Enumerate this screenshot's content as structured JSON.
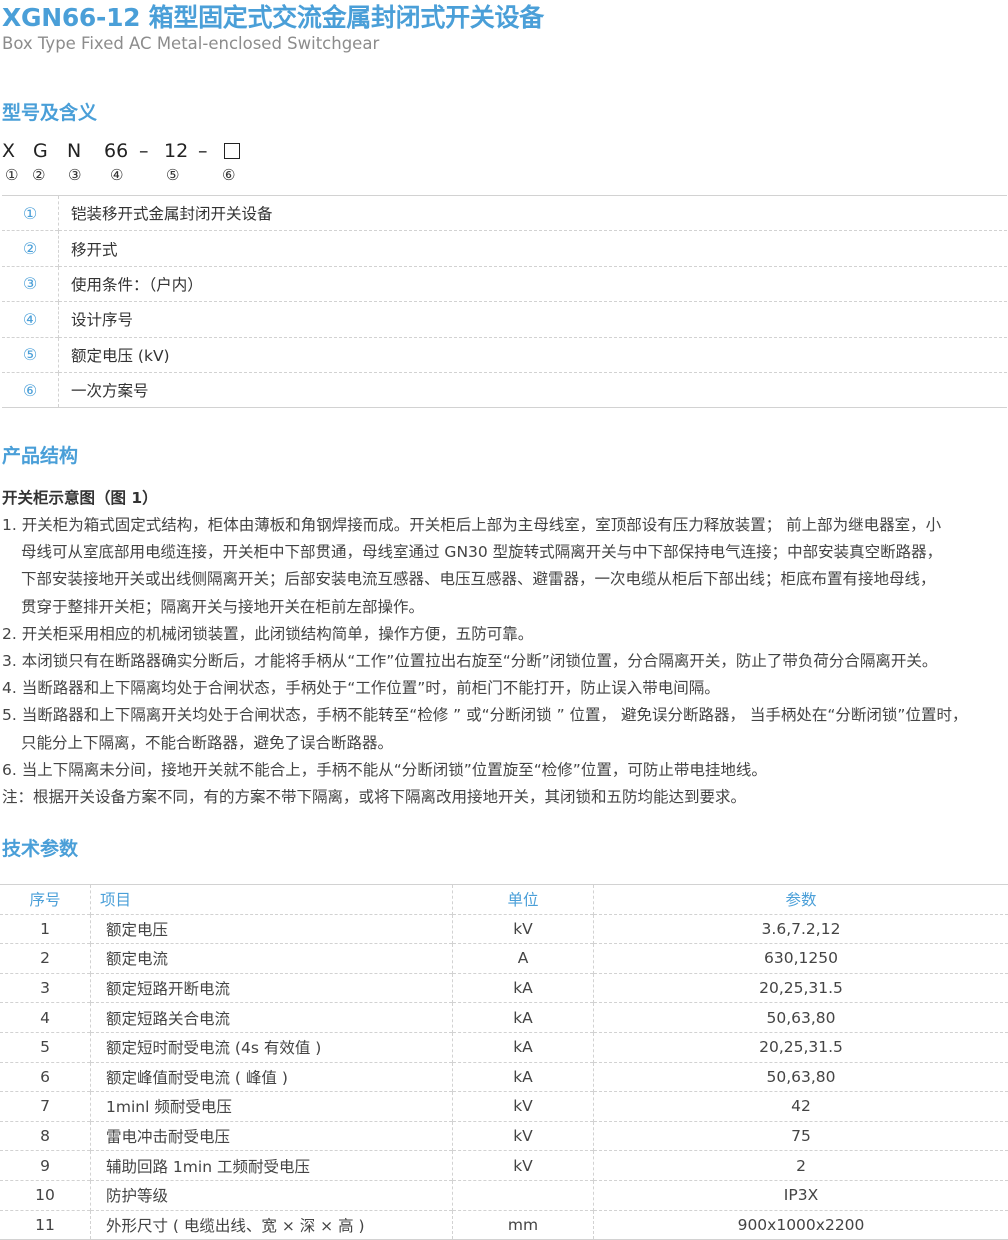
{
  "header": {
    "title": "XGN66-12 箱型固定式交流金属封闭式开关设备",
    "subtitle": "Box Type Fixed AC Metal-enclosed Switchgear"
  },
  "model_section": {
    "heading": "型号及含义",
    "code_parts": [
      "X",
      "G",
      "N",
      "66",
      "–",
      "12",
      "–"
    ],
    "circled": [
      "①",
      "②",
      "③",
      "④",
      "⑤",
      "⑥"
    ],
    "meanings": [
      {
        "num": "①",
        "text": "铠装移开式金属封闭开关设备"
      },
      {
        "num": "②",
        "text": "移开式"
      },
      {
        "num": "③",
        "text": "使用条件：（户内）"
      },
      {
        "num": "④",
        "text": "设计序号"
      },
      {
        "num": "⑤",
        "text": "额定电压 (kV)"
      },
      {
        "num": "⑥",
        "text": "一次方案号"
      }
    ]
  },
  "structure_section": {
    "heading": "产品结构",
    "figure_title": "开关柜示意图（图 1）",
    "lines": [
      "1. 开关柜为箱式固定式结构，柜体由薄板和角钢焊接而成。开关柜后上部为主母线室，室顶部设有压力释放装置；  前上部为继电器室，小",
      "母线可从室底部用电缆连接，开关柜中下部贯通，母线室通过 GN30 型旋转式隔离开关与中下部保持电气连接；中部安装真空断路器，",
      "下部安装接地开关或出线侧隔离开关；后部安装电流互感器、电压互感器、避雷器，一次电缆从柜后下部出线；柜底布置有接地母线，",
      "贯穿于整排开关柜；隔离开关与接地开关在柜前左部操作。",
      "2. 开关柜采用相应的机械闭锁装置，此闭锁结构简单，操作方便，五防可靠。",
      "3. 本闭锁只有在断路器确实分断后，才能将手柄从“工作”位置拉出右旋至“分断”闭锁位置，分合隔离开关，防止了带负荷分合隔离开关。",
      "4. 当断路器和上下隔离均处于合闸状态，手柄处于“工作位置”时，前柜门不能打开，防止误入带电间隔。",
      "5. 当断路器和上下隔离开关均处于合闸状态，手柄不能转至“检修 ” 或“分断闭锁 ” 位置，  避免误分断路器，  当手柄处在“分断闭锁”位置时，",
      "只能分上下隔离，不能合断路器，避免了误合断路器。",
      "6. 当上下隔离未分间，接地开关就不能合上，手柄不能从“分断闭锁”位置旋至“检修”位置，可防止带电挂地线。",
      "注：根据开关设备方案不同，有的方案不带下隔离，或将下隔离改用接地开关，其闭锁和五防均能达到要求。"
    ]
  },
  "params_section": {
    "heading": "技术参数",
    "columns": [
      "序号",
      "项目",
      "单位",
      "参数"
    ],
    "rows": [
      {
        "no": "1",
        "item": "额定电压",
        "unit": "kV",
        "value": "3.6,7.2,12"
      },
      {
        "no": "2",
        "item": "额定电流",
        "unit": "A",
        "value": "630,1250"
      },
      {
        "no": "3",
        "item": "额定短路开断电流",
        "unit": "kA",
        "value": "20,25,31.5"
      },
      {
        "no": "4",
        "item": "额定短路关合电流",
        "unit": "kA",
        "value": "50,63,80"
      },
      {
        "no": "5",
        "item": "额定短时耐受电流 (4s 有效值 )",
        "unit": "kA",
        "value": "20,25,31.5"
      },
      {
        "no": "6",
        "item": "额定峰值耐受电流 ( 峰值 )",
        "unit": "kA",
        "value": "50,63,80"
      },
      {
        "no": "7",
        "item": "1minl 频耐受电压",
        "unit": "kV",
        "value": "42"
      },
      {
        "no": "8",
        "item": "雷电冲击耐受电压",
        "unit": "kV",
        "value": "75"
      },
      {
        "no": "9",
        "item": "辅助回路 1min 工频耐受电压",
        "unit": "kV",
        "value": "2"
      },
      {
        "no": "10",
        "item": "防护等级",
        "unit": "",
        "value": "IP3X"
      },
      {
        "no": "11",
        "item": "外形尺寸 ( 电缆出线、宽 × 深 × 高 )",
        "unit": "mm",
        "value": "900x1000x2200"
      }
    ]
  }
}
